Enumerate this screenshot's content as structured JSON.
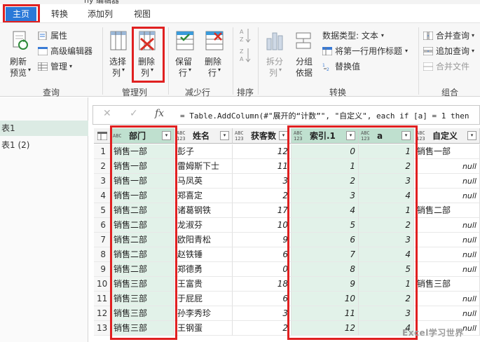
{
  "window": {
    "title_fragment": "ny 编辑器"
  },
  "tabs": [
    {
      "label": "主页",
      "active": true
    },
    {
      "label": "转换"
    },
    {
      "label": "添加列"
    },
    {
      "label": "视图"
    }
  ],
  "ribbon": {
    "groups": {
      "query": "查询",
      "manage_cols": "管理列",
      "reduce_rows": "减少行",
      "sort": "排序",
      "transform": "转换",
      "combine": "组合"
    },
    "refresh": {
      "line1": "刷新",
      "line2": "预览"
    },
    "properties": "属性",
    "advanced_editor": "高级编辑器",
    "manage": "管理",
    "choose_cols": {
      "line1": "选择",
      "line2": "列"
    },
    "remove_cols": {
      "line1": "删除",
      "line2": "列"
    },
    "keep_rows": {
      "line1": "保留",
      "line2": "行"
    },
    "remove_rows": {
      "line1": "删除",
      "line2": "行"
    },
    "split": {
      "line1": "拆分",
      "line2": "列"
    },
    "group_by": {
      "line1": "分组",
      "line2": "依据"
    },
    "data_type": "数据类型: 文本",
    "first_row_header": "将第一行用作标题",
    "replace_values": "替换值",
    "merge_queries": "合并查询",
    "append_queries": "追加查询",
    "combine_files": "合并文件"
  },
  "queries": [
    {
      "label": "表1",
      "selected": true
    },
    {
      "label": "表1 (2)"
    }
  ],
  "formula_bar": {
    "cancel": "✕",
    "confirm": "✓",
    "fx": "fx",
    "formula": "= Table.AddColumn(#\"展开的“计数”\", \"自定义\", each if [a] = 1 then"
  },
  "grid": {
    "columns": [
      {
        "name": "部门",
        "type": "ABC"
      },
      {
        "name": "姓名",
        "type": "ABC 123"
      },
      {
        "name": "获客数",
        "type": "ABC 123"
      },
      {
        "name": "索引.1",
        "type": "ABC 123"
      },
      {
        "name": "a",
        "type": "ABC 123"
      },
      {
        "name": "自定义",
        "type": "ABC 123"
      }
    ],
    "rows": [
      [
        "1",
        "销售一部",
        "彭子",
        "12",
        "0",
        "1",
        "销售一部"
      ],
      [
        "2",
        "销售一部",
        "雷姆斯下士",
        "11",
        "1",
        "2",
        "null"
      ],
      [
        "3",
        "销售一部",
        "马凤英",
        "3",
        "2",
        "3",
        "null"
      ],
      [
        "4",
        "销售一部",
        "郑喜定",
        "2",
        "3",
        "4",
        "null"
      ],
      [
        "5",
        "销售二部",
        "诸葛钢铁",
        "17",
        "4",
        "1",
        "销售二部"
      ],
      [
        "6",
        "销售二部",
        "龙淑芬",
        "10",
        "5",
        "2",
        "null"
      ],
      [
        "7",
        "销售二部",
        "欧阳青松",
        "9",
        "6",
        "3",
        "null"
      ],
      [
        "8",
        "销售二部",
        "赵铁锤",
        "6",
        "7",
        "4",
        "null"
      ],
      [
        "9",
        "销售二部",
        "郑德勇",
        "0",
        "8",
        "5",
        "null"
      ],
      [
        "10",
        "销售三部",
        "王富贵",
        "18",
        "9",
        "1",
        "销售三部"
      ],
      [
        "11",
        "销售三部",
        "于屁屁",
        "6",
        "10",
        "2",
        "null"
      ],
      [
        "12",
        "销售三部",
        "孙李秀珍",
        "3",
        "11",
        "3",
        "null"
      ],
      [
        "13",
        "销售三部",
        "王钢蛋",
        "2",
        "12",
        "4",
        "null"
      ]
    ]
  },
  "watermark": "Excel学习世界",
  "colors": {
    "accent_tab": "#2b79d8",
    "highlight": "#e02020",
    "selected_col": "#e2f2e9"
  }
}
